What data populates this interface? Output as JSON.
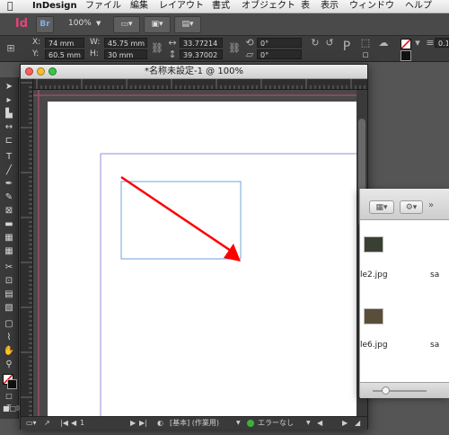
{
  "menubar": {
    "apple": "",
    "app_name": "InDesign",
    "items": [
      "ファイル",
      "編集",
      "レイアウト",
      "書式",
      "オブジェクト",
      "表",
      "表示",
      "ウィンドウ",
      "ヘルプ"
    ]
  },
  "appbar": {
    "logo": "Id",
    "bridge": "Br",
    "zoom": "100%"
  },
  "control": {
    "x_label": "X:",
    "x_value": "74 mm",
    "y_label": "Y:",
    "y_value": "60.5 mm",
    "w_label": "W:",
    "w_value": "45.75 mm",
    "h_label": "H:",
    "h_value": "30 mm",
    "scale_x": "33.77214",
    "scale_y": "39.37002",
    "rotate": "0°",
    "shear": "0°",
    "stroke": "0.1 n"
  },
  "document": {
    "title": "*名称未設定-1 @ 100%",
    "page_number": "1",
    "page_style": "[基本] (作業用)",
    "preflight": "エラーなし",
    "colors": {
      "page_margin": "#d06a8a",
      "column_guide": "#9a8bd8",
      "frame": "#6fa3d8",
      "arrow": "#ff0000",
      "preflight_ok": "#39b339"
    }
  },
  "finder": {
    "items": [
      {
        "name": "le2.jpg"
      },
      {
        "name": "sa"
      },
      {
        "name": "le6.jpg"
      },
      {
        "name": "sa"
      }
    ]
  }
}
